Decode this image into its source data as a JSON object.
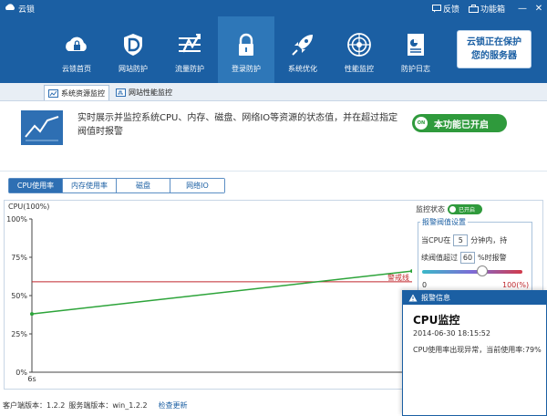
{
  "app": {
    "title": "云锁"
  },
  "titlebar": {
    "feedback": "反馈",
    "toolbox": "功能箱",
    "minimize": "—",
    "close": "✕"
  },
  "nav": {
    "items": [
      {
        "label": "云锁首页",
        "icon": "cloud-lock-icon"
      },
      {
        "label": "网站防护",
        "icon": "shield-d-icon"
      },
      {
        "label": "流量防护",
        "icon": "flow-icon"
      },
      {
        "label": "登录防护",
        "icon": "padlock-icon"
      },
      {
        "label": "系统优化",
        "icon": "rocket-icon"
      },
      {
        "label": "性能监控",
        "icon": "radar-icon"
      },
      {
        "label": "防护日志",
        "icon": "log-icon"
      }
    ],
    "active_index": 3
  },
  "promo": {
    "line1": "云锁正在保护",
    "line2": "您的服务器"
  },
  "subnav": {
    "tab1": "系统资源监控",
    "tab2": "网站性能监控"
  },
  "info": {
    "description": "实时展示并监控系统CPU、内存、磁盘、网络IO等资源的状态值，并在超过指定阀值时报警",
    "toggle_icon_text": "ON",
    "toggle_label": "本功能已开启"
  },
  "tabs": [
    "CPU使用率",
    "内存使用率",
    "磁盘",
    "网络IO"
  ],
  "chart_data": {
    "type": "line",
    "title": "CPU(100%)",
    "y_ticks": [
      "100%",
      "75%",
      "50%",
      "25%",
      "0%"
    ],
    "x_ticks": [
      "6s"
    ],
    "ylim": [
      0,
      100
    ],
    "series": [
      {
        "values": [
          {
            "x": 0,
            "y": 38
          },
          {
            "x": 1,
            "y": 66
          }
        ],
        "color": "#2da43a"
      }
    ],
    "threshold": {
      "value": 59,
      "label": "警戒线",
      "color": "#c0282d"
    }
  },
  "settings": {
    "monitor_status_label": "监控状态",
    "monitor_toggle": "已开启",
    "threshold_legend": "报警阀值设置",
    "row1_pre": "当CPU在",
    "row1_value": "5",
    "row1_post": "分钟内，持",
    "row2_pre": "续阀值超过",
    "row2_value": "60",
    "row2_post": "%时报警",
    "slider_min": "0",
    "slider_max": "100(%)",
    "slider_level": 0.6
  },
  "popup": {
    "header": "报警信息",
    "title": "CPU监控",
    "time": "2014-06-30 18:15:52",
    "message": "CPU使用率出现异常，当前使用率:79%"
  },
  "footer": {
    "client_version": "客户端版本：1.2.2",
    "server_version": "服务端版本：win_1.2.2",
    "check_update": "检查更新"
  }
}
